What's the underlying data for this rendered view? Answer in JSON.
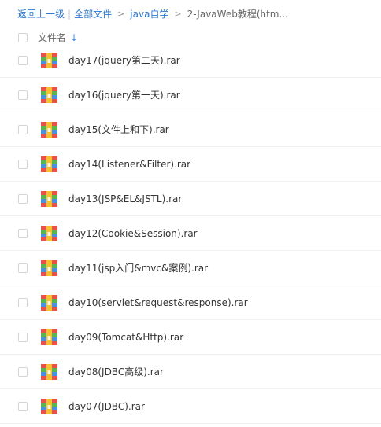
{
  "breadcrumb": {
    "back": "返回上一级",
    "separator": "|",
    "all_files": "全部文件",
    "arrow": ">",
    "folder": "java自学",
    "current": "2-JavaWeb教程(htm..."
  },
  "header": {
    "column_label": "文件名",
    "sort_icon": "arrow-down-icon",
    "sort_glyph": "↓"
  },
  "files": [
    {
      "name": "day17(jquery第二天).rar",
      "icon": "rar-archive-icon"
    },
    {
      "name": "day16(jquery第一天).rar",
      "icon": "rar-archive-icon"
    },
    {
      "name": "day15(文件上和下).rar",
      "icon": "rar-archive-icon"
    },
    {
      "name": "day14(Listener&Filter).rar",
      "icon": "rar-archive-icon"
    },
    {
      "name": "day13(JSP&EL&JSTL).rar",
      "icon": "rar-archive-icon"
    },
    {
      "name": "day12(Cookie&Session).rar",
      "icon": "rar-archive-icon"
    },
    {
      "name": "day11(jsp入门&mvc&案例).rar",
      "icon": "rar-archive-icon"
    },
    {
      "name": "day10(servlet&request&response).rar",
      "icon": "rar-archive-icon"
    },
    {
      "name": "day09(Tomcat&Http).rar",
      "icon": "rar-archive-icon"
    },
    {
      "name": "day08(JDBC高级).rar",
      "icon": "rar-archive-icon"
    },
    {
      "name": "day07(JDBC).rar",
      "icon": "rar-archive-icon"
    }
  ],
  "colors": {
    "link": "#2a78d2",
    "sort_arrow": "#3b8cf0",
    "icon_red": "#e8504a",
    "icon_green": "#5ab551",
    "icon_blue": "#4a8fe0",
    "icon_yellow": "#f6c12d"
  }
}
